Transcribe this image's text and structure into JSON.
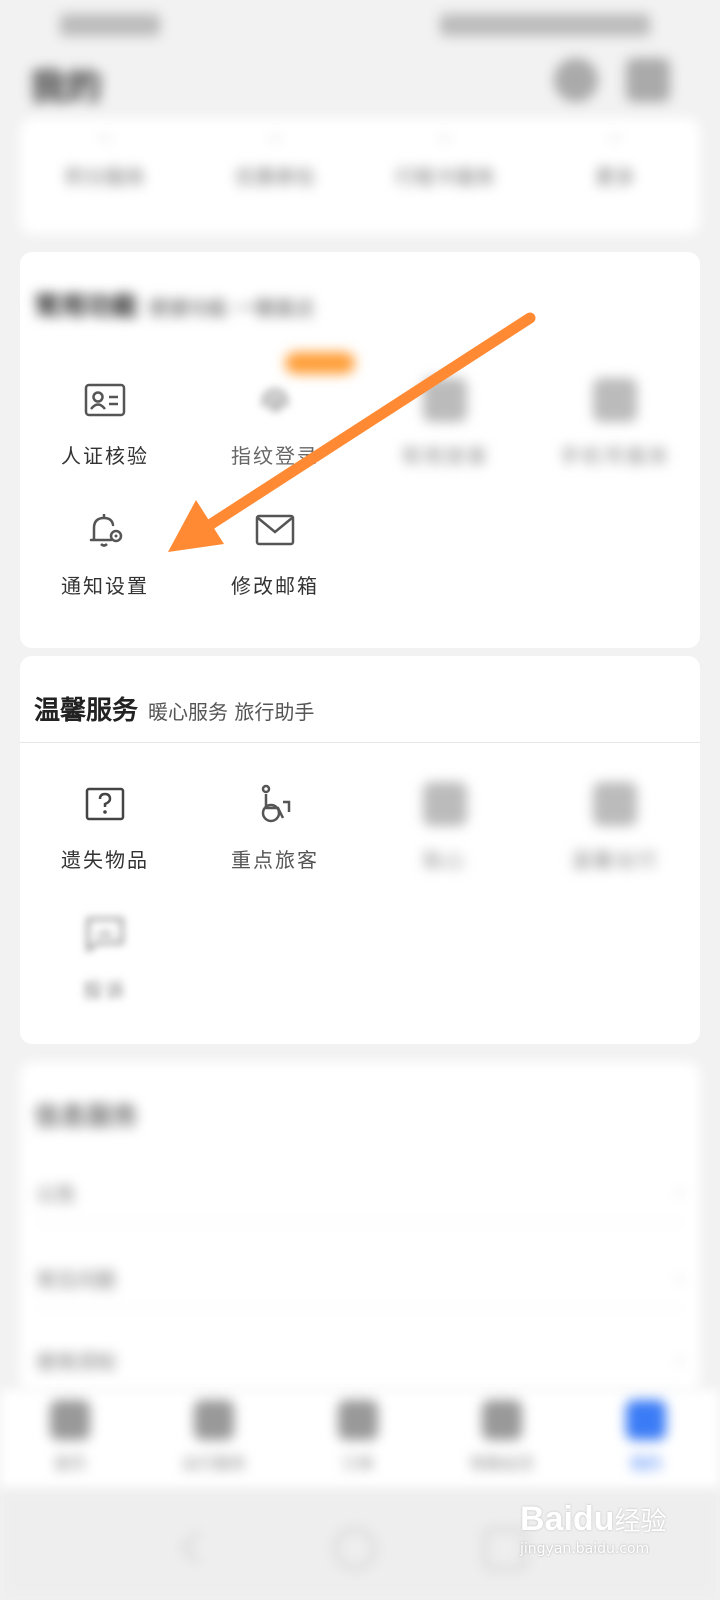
{
  "header": {
    "title": "我的"
  },
  "stats": [
    {
      "num": "--",
      "label": "积分服务"
    },
    {
      "num": "--",
      "label": "优惠券包"
    },
    {
      "num": "--",
      "label": "行程卡服务"
    },
    {
      "num": "--",
      "label": "更多"
    }
  ],
  "common_functions": {
    "title": "常用功能",
    "subtitle": "便捷功能 一键直达",
    "items": [
      {
        "label": "人证核验",
        "icon": "id-card-icon"
      },
      {
        "label": "指纹登录",
        "icon": "fingerprint-icon"
      },
      {
        "label": "常用旅客",
        "icon": "passenger-icon"
      },
      {
        "label": "手机号服务",
        "icon": "phone-icon"
      },
      {
        "label": "通知设置",
        "icon": "bell-gear-icon"
      },
      {
        "label": "修改邮箱",
        "icon": "mail-icon"
      }
    ]
  },
  "warm_services": {
    "title": "温馨服务",
    "subtitle": "暖心服务 旅行助手",
    "items": [
      {
        "label": "遗失物品",
        "icon": "question-box-icon"
      },
      {
        "label": "重点旅客",
        "icon": "wheelchair-icon"
      },
      {
        "label": "贴心",
        "icon": "service-icon"
      },
      {
        "label": "温馨出行",
        "icon": "seat-icon"
      },
      {
        "label": "投诉",
        "icon": "chat-complaint-icon"
      }
    ]
  },
  "info_services": {
    "title": "信息服务",
    "items": [
      {
        "label": "公告"
      },
      {
        "label": "常见问题"
      },
      {
        "label": "使用须知"
      }
    ]
  },
  "tabbar": [
    {
      "label": "首页",
      "icon": "home-icon"
    },
    {
      "label": "出行服务",
      "icon": "service-tab-icon"
    },
    {
      "label": "订单",
      "icon": "order-icon"
    },
    {
      "label": "铁路会员",
      "icon": "member-icon"
    },
    {
      "label": "我的",
      "icon": "profile-icon"
    }
  ],
  "watermark": {
    "logo": "Baidu",
    "cn": "经验",
    "url": "jingyan.baidu.com"
  },
  "colors": {
    "accent": "#ff8a33",
    "tab_active": "#3b7cf6"
  }
}
